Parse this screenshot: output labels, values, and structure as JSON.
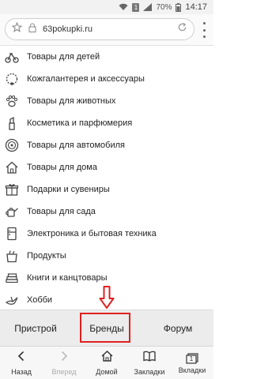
{
  "status_bar": {
    "battery": "70%",
    "time": "14:17",
    "sim_label": "1"
  },
  "url_bar": {
    "url": "63pokupki.ru"
  },
  "categories": [
    {
      "label": "Товары для детей",
      "icon": "tricycle-icon"
    },
    {
      "label": "Кожгалантерея и аксессуары",
      "icon": "necklace-icon"
    },
    {
      "label": "Товары для животных",
      "icon": "paw-icon"
    },
    {
      "label": "Косметика и парфюмерия",
      "icon": "lipstick-icon"
    },
    {
      "label": "Товары для автомобиля",
      "icon": "wheel-icon"
    },
    {
      "label": "Товары для дома",
      "icon": "house-icon"
    },
    {
      "label": "Подарки и сувениры",
      "icon": "gift-icon"
    },
    {
      "label": "Товары для сада",
      "icon": "watering-can-icon"
    },
    {
      "label": "Электроника и бытовая техника",
      "icon": "fridge-icon"
    },
    {
      "label": "Продукты",
      "icon": "grocery-bag-icon"
    },
    {
      "label": "Книги и канцтовары",
      "icon": "books-icon"
    },
    {
      "label": "Хобби",
      "icon": "bird-icon"
    }
  ],
  "subnav": {
    "pristroy": "Пристрой",
    "brands": "Бренды",
    "forum": "Форум"
  },
  "bottom_bar": {
    "back": "Назад",
    "forward": "Вперед",
    "home": "Домой",
    "bookmarks": "Закладки",
    "tabs": "Вкладки",
    "tabs_count": "1"
  },
  "colors": {
    "highlight": "#e02020",
    "subnav_bg": "#ececec"
  }
}
